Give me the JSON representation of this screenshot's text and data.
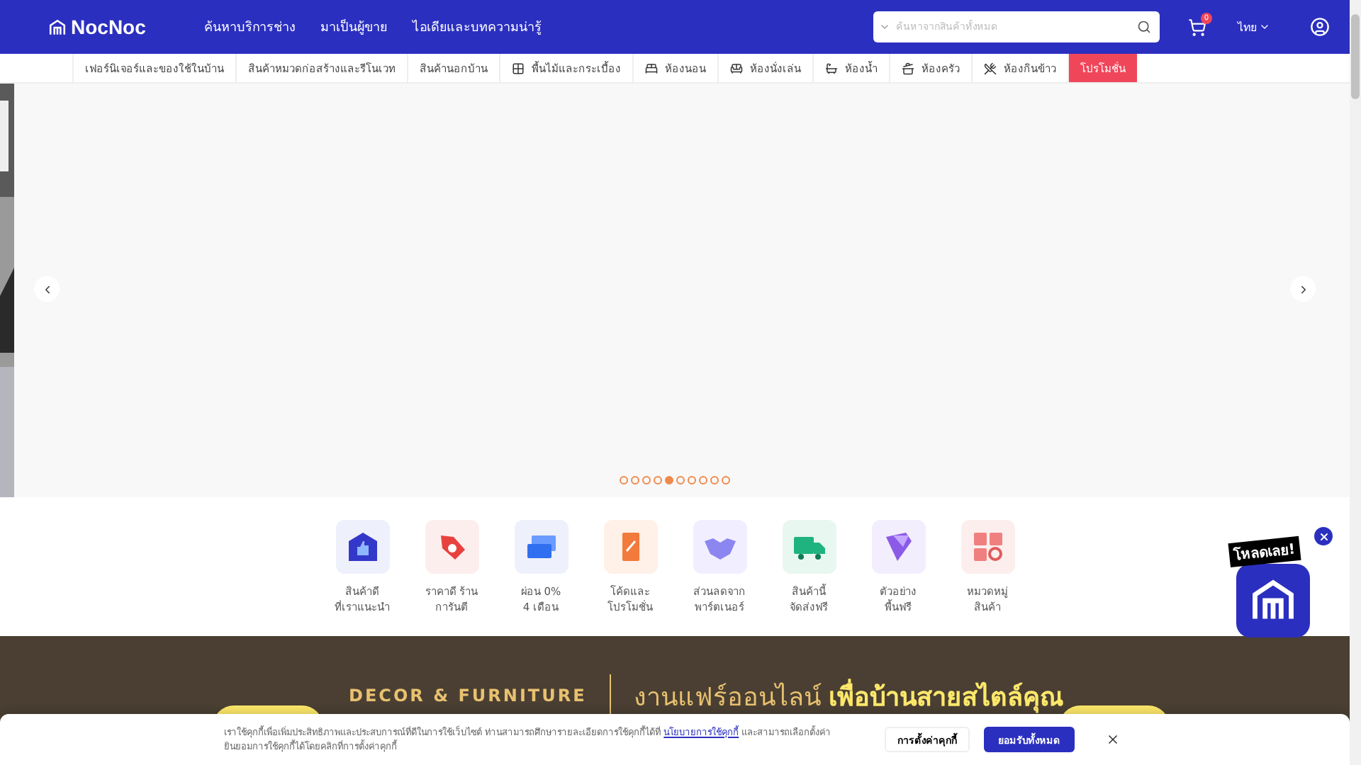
{
  "header": {
    "logo": "NocNoc",
    "nav": [
      "ค้นหาบริการช่าง",
      "มาเป็นผู้ขาย",
      "ไอเดียและบทความน่ารู้"
    ],
    "search": {
      "placeholder": "ค้นหาจากสินค้าทั้งหมด"
    },
    "cart_count": "0",
    "language": "ไทย"
  },
  "categories": [
    {
      "label": "เฟอร์นิเจอร์และของใช้ในบ้าน",
      "kind": "text",
      "highlight": false
    },
    {
      "label": "สินค้าหมวดก่อสร้างและรีโนเวท",
      "kind": "text",
      "highlight": false
    },
    {
      "label": "สินค้านอกบ้าน",
      "kind": "text",
      "highlight": false
    },
    {
      "label": "พื้นไม้และกระเบื้อง",
      "kind": "floor",
      "highlight": false
    },
    {
      "label": "ห้องนอน",
      "kind": "bed",
      "highlight": false
    },
    {
      "label": "ห้องนั่งเล่น",
      "kind": "sofa",
      "highlight": false
    },
    {
      "label": "ห้องน้ำ",
      "kind": "bath",
      "highlight": false
    },
    {
      "label": "ห้องครัว",
      "kind": "kitchen",
      "highlight": false
    },
    {
      "label": "ห้องกินข้าว",
      "kind": "dining",
      "highlight": false
    },
    {
      "label": "โปรโมชั่น",
      "kind": "text",
      "highlight": true
    }
  ],
  "carousel": {
    "dots": [
      {
        "selected": false
      },
      {
        "selected": false
      },
      {
        "selected": false
      },
      {
        "selected": false
      },
      {
        "selected": true
      },
      {
        "selected": false
      },
      {
        "selected": false
      },
      {
        "selected": false
      },
      {
        "selected": false
      },
      {
        "selected": false
      }
    ]
  },
  "features": [
    {
      "kind": "thumb",
      "lines": [
        "สินค้าดี",
        "ที่เราแนะนำ"
      ]
    },
    {
      "kind": "tag",
      "lines": [
        "ราคาดี ร้าน",
        "การันตี"
      ]
    },
    {
      "kind": "card",
      "lines": [
        "ผ่อน 0%",
        "4 เดือน"
      ]
    },
    {
      "kind": "coupon",
      "lines": [
        "โค้ดและ",
        "โปรโมชั่น"
      ]
    },
    {
      "kind": "handshake",
      "lines": [
        "ส่วนลดจาก",
        "พาร์ตเนอร์"
      ]
    },
    {
      "kind": "truck",
      "lines": [
        "สินค้านี้",
        "จัดส่งฟรี"
      ]
    },
    {
      "kind": "swatch",
      "lines": [
        "ตัวอย่าง",
        "พื้นฟรี"
      ]
    },
    {
      "kind": "grid",
      "lines": [
        "หมวดหมู่",
        "สินค้า"
      ]
    }
  ],
  "banner": {
    "tag": "DECOR & FURNITURE",
    "headline": "งานแฟร์ออนไลน์ **เพื่อบ้านสายสไตล์คุณ**"
  },
  "app_promo": {
    "label": "โหลดเลย!"
  },
  "cookie_bar": {
    "text_before": "เราใช้คุกกี้เพื่อเพิ่มประสิทธิภาพและประสบการณ์ที่ดีในการใช้เว็บไซต์ ท่านสามารถศึกษารายละเอียดการใช้คุกกี้ได้ที่",
    "link": "นโยบายการใช้คุกกี้",
    "text_after": "และสามารถเลือกตั้งค่ายินยอมการใช้คุกกี้ได้โดยคลิกที่การตั้งค่าคุกกี้",
    "settings_button": "การตั้งค่าคุกกี้",
    "accept_button": "ยอมรับทั้งหมด"
  }
}
